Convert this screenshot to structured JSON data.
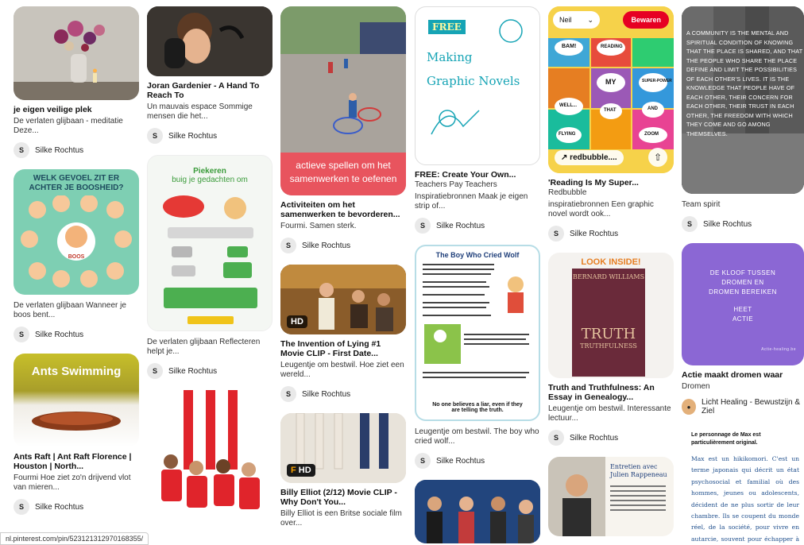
{
  "pins": {
    "c1p1": {
      "title": "je eigen veilige plek",
      "desc": "De verlaten glijbaan - meditatie Deze...",
      "avatar": "S",
      "author": "Silke Rochtus"
    },
    "c1p2": {
      "img_title": "WELK GEVOEL ZIT ER ACHTER JE BOOSHEID?",
      "img_center": "BOOS",
      "desc": "De verlaten glijbaan Wanneer je boos bent...",
      "avatar": "S",
      "author": "Silke Rochtus"
    },
    "c1p3": {
      "img_text": "Ants Swimming",
      "title": "Ants Raft | Ant Raft Florence | Houston | North...",
      "desc": "Fourmi Hoe ziet zo'n drijvend vlot van mieren...",
      "avatar": "S",
      "author": "Silke Rochtus"
    },
    "c2p1": {
      "title": "Joran Gardenier - A Hand To Reach To",
      "desc": "Un mauvais espace Sommige mensen die het...",
      "avatar": "S",
      "author": "Silke Rochtus"
    },
    "c2p2": {
      "img_title": "Piekeren",
      "img_sub": "buig je gedachten om",
      "desc": "De verlaten glijbaan Reflecteren helpt je...",
      "avatar": "S",
      "author": "Silke Rochtus"
    },
    "c3p1": {
      "img_text": "actieve spellen om het samenwerken te oefenen",
      "title": "Activiteiten om het samenwerken te bevorderen...",
      "desc": "Fourmi. Samen sterk.",
      "avatar": "S",
      "author": "Silke Rochtus"
    },
    "c3p2": {
      "badge": "HD",
      "title": "The Invention of Lying #1 Movie CLIP - First Date...",
      "desc": "Leugentje om bestwil. Hoe ziet een wereld...",
      "avatar": "S",
      "author": "Silke Rochtus"
    },
    "c3p3": {
      "badge": "HD",
      "title": "Billy Elliot (2/12) Movie CLIP - Why Don't You...",
      "desc": "Billy Elliot is een Britse sociale film over..."
    },
    "c4p1": {
      "img_free": "FREE",
      "img_title": "Making Graphic Novels",
      "title": "FREE: Create Your Own...",
      "desc1": "Teachers Pay Teachers",
      "desc2": "Inspiratiebronnen Maak je eigen strip of...",
      "avatar": "S",
      "author": "Silke Rochtus"
    },
    "c4p2": {
      "img_title": "The Boy Who Cried Wolf",
      "img_bottom": "No one believes a liar, even if they are telling the truth.",
      "desc": "Leugentje om bestwil. The boy who cried wolf...",
      "avatar": "S",
      "author": "Silke Rochtus"
    },
    "c5p1": {
      "board": "Neil",
      "save": "Bewaren",
      "link": "redbubble....",
      "bubbles": [
        "BAM!",
        "READING",
        "MY",
        "SUPER-POWER",
        "WELL...",
        "THAT",
        "AND",
        "FLYING",
        "ZOOM"
      ],
      "title": "'Reading Is My Super...",
      "desc1": "Redbubble",
      "desc2": "inspiratiebronnen Een graphic novel wordt ook...",
      "avatar": "S",
      "author": "Silke Rochtus"
    },
    "c5p2": {
      "look": "LOOK INSIDE!",
      "book_author": "BERNARD WILLIAMS",
      "book_title": "TRUTH",
      "book_sub": "TRUTHFULNESS",
      "title": "Truth and Truthfulness: An Essay in Genealogy...",
      "desc": "Leugentje om bestwil. Interessante lectuur...",
      "avatar": "S",
      "author": "Silke Rochtus"
    },
    "c5p3": {
      "mag_title": "Entretien avec Julien Rappeneau"
    },
    "c6p1": {
      "quote": "A COMMUNITY IS THE MENTAL AND SPIRITUAL CONDITION OF KNOWING THAT THE PLACE IS SHARED, AND THAT THE PEOPLE WHO SHARE THE PLACE DEFINE AND LIMIT THE POSSIBILITIES OF EACH OTHER'S LIVES. IT IS THE KNOWLEDGE THAT PEOPLE HAVE OF EACH OTHER, THEIR CONCERN FOR EACH OTHER, THEIR TRUST IN EACH OTHER, THE FREEDOM WITH WHICH THEY COME AND GO AMONG THEMSELVES.",
      "title": "Team spirit",
      "avatar": "S",
      "author": "Silke Rochtus"
    },
    "c6p2": {
      "img_lines": [
        "DE KLOOF TUSSEN",
        "DROMEN EN",
        "DROMEN BEREIKEN",
        "",
        "HEET",
        "ACTIE"
      ],
      "img_small": "Actie-healing.be",
      "title": "Actie maakt dromen waar",
      "desc": "Dromen",
      "author": "Licht Healing - Bewustzijn & Ziel"
    },
    "c6p3": {
      "head": "Le personnage de Max est particulièrement original.",
      "body": "Max est un hikikomori. C'est un terme japonais qui décrit un état psychosocial et familial où des hommes, jeunes ou adolescents, décident de ne plus sortir de leur chambre. Ils se coupent du monde réel, de la société, pour vivre en autarcie, souvent pour échapper à la pression scolaire ou sociale. La"
    }
  },
  "status_url": "nl.pinterest.com/pin/523121312970168355/",
  "colors": {
    "save": "#e60023",
    "kloof": "#8b67d4",
    "activiteiten": "#e8545e"
  }
}
